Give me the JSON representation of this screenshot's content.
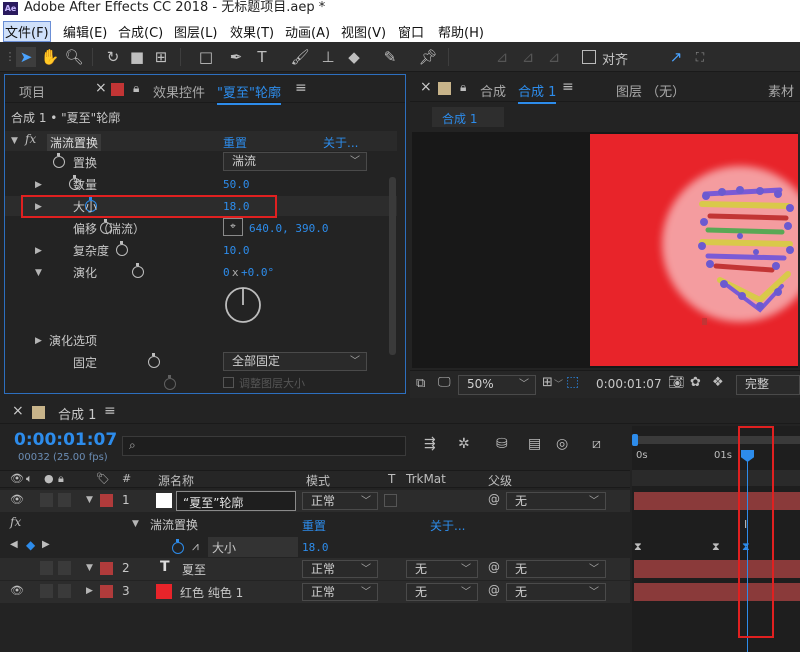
{
  "window": {
    "app_icon": "Ae",
    "title": "Adobe After Effects CC 2018 - 无标题项目.aep *"
  },
  "menu": [
    "文件(F)",
    "编辑(E)",
    "合成(C)",
    "图层(L)",
    "效果(T)",
    "动画(A)",
    "视图(V)",
    "窗口",
    "帮助(H)"
  ],
  "toolbar": {
    "align_label": "对齐"
  },
  "left_panel": {
    "tab_project": "项目",
    "tab_effects": "效果控件",
    "tab_effects_layer": "\"夏至\"轮廓",
    "breadcrumb": "合成 1 • \"夏至\"轮廓",
    "effect": {
      "name": "湍流置换",
      "reset": "重置",
      "about": "关于..."
    },
    "props": [
      {
        "label": "置换",
        "value": "湍流"
      },
      {
        "label": "数量",
        "value": "50.0"
      },
      {
        "label": "大小",
        "value": "18.0"
      },
      {
        "label": "偏移（湍流）",
        "value": "640.0, 390.0"
      },
      {
        "label": "复杂度",
        "value": "10.0"
      },
      {
        "label": "演化",
        "value_x": "0",
        "value_mult": "x",
        "value_deg": "+0.0°"
      }
    ],
    "evolution_options": "演化选项",
    "pinning": {
      "label": "固定",
      "value": "全部固定"
    },
    "resize_layer": "调整图层大小"
  },
  "comp_panel": {
    "tab_comp": "合成",
    "tab_comp_name": "合成 1",
    "tab_layer": "图层 （无）",
    "tab_footage": "素材",
    "sub_tab": "合成 1",
    "zoom": "50%",
    "timecode": "0:00:01:07",
    "quality": "完整",
    "bg_color": "#e8242a"
  },
  "timeline": {
    "tab": "合成 1",
    "timecode": "0:00:01:07",
    "frames": "00032 (25.00 fps)",
    "ruler": [
      "0s",
      "01s"
    ],
    "columns": {
      "num": "#",
      "source": "源名称",
      "mode": "模式",
      "t": "T",
      "trkmat": "TrkMat",
      "parent": "父级"
    },
    "layers": [
      {
        "num": "1",
        "name": "“夏至”轮廓",
        "mode": "正常",
        "trkmat": "",
        "parent": "无",
        "color": "#b03b3b",
        "swatch": "#ffffff"
      },
      {
        "num": "2",
        "name": "夏至",
        "mode": "正常",
        "trkmat": "无",
        "parent": "无",
        "color": "#b03b3b",
        "type_icon": "T"
      },
      {
        "num": "3",
        "name": "红色 纯色 1",
        "mode": "正常",
        "trkmat": "无",
        "parent": "无",
        "color": "#b03b3b",
        "swatch": "#e8242a"
      }
    ],
    "effect_row": {
      "name": "湍流置换",
      "reset": "重置",
      "about": "关于..."
    },
    "size_row": {
      "label": "大小",
      "value": "18.0"
    },
    "fx_label": "fx"
  },
  "colors": {
    "accent": "#2d8ceb",
    "highlight": "#e02020",
    "label_red": "#b03b3b"
  }
}
